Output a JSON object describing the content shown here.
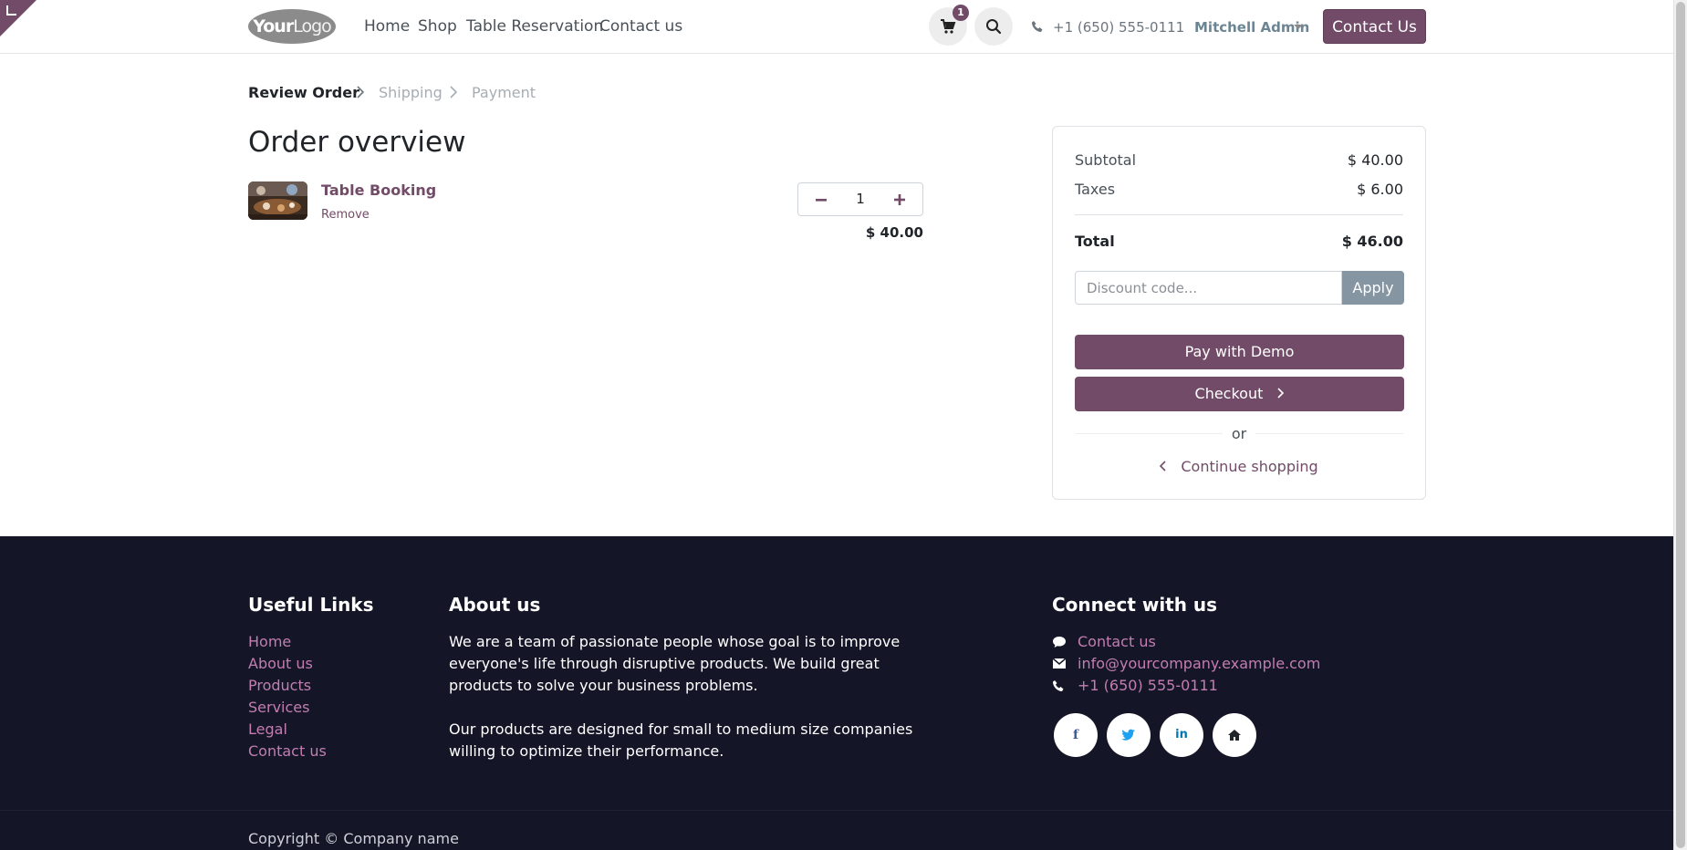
{
  "header": {
    "logo": {
      "bold": "Your",
      "light": "Logo"
    },
    "nav": [
      "Home",
      "Shop",
      "Table Reservation",
      "Contact us"
    ],
    "cart_count": "1",
    "phone": "+1 (650) 555-0111",
    "user": "Mitchell Admin",
    "contact_button": "Contact Us"
  },
  "breadcrumb": [
    "Review Order",
    "Shipping",
    "Payment"
  ],
  "page_title": "Order overview",
  "cart_line": {
    "name": "Table Booking",
    "remove": "Remove",
    "quantity": "1",
    "price": "$ 40.00"
  },
  "summary": {
    "subtotal_label": "Subtotal",
    "subtotal": "$ 40.00",
    "taxes_label": "Taxes",
    "taxes": "$ 6.00",
    "total_label": "Total",
    "total": "$ 46.00",
    "discount_placeholder": "Discount code...",
    "apply": "Apply",
    "pay_demo": "Pay with Demo",
    "checkout": "Checkout",
    "or": "or",
    "continue": "Continue shopping"
  },
  "footer": {
    "useful_links_title": "Useful Links",
    "useful_links": [
      "Home",
      "About us",
      "Products",
      "Services",
      "Legal",
      "Contact us"
    ],
    "about_title": "About us",
    "about_p1": "We are a team of passionate people whose goal is to improve everyone's life through disruptive products. We build great products to solve your business problems.",
    "about_p2": "Our products are designed for small to medium size companies willing to optimize their performance.",
    "connect_title": "Connect with us",
    "connect": {
      "contact": "Contact us",
      "email": "info@yourcompany.example.com",
      "phone": "+1 (650) 555-0111"
    },
    "social_icons": [
      "facebook-icon",
      "twitter-icon",
      "linkedin-icon",
      "home-icon"
    ],
    "copyright": "Copyright © Company name"
  },
  "colors": {
    "brand": "#714B67",
    "footer_bg": "#141628",
    "footer_link": "#c27db1",
    "apply_bg": "#8595a2"
  }
}
